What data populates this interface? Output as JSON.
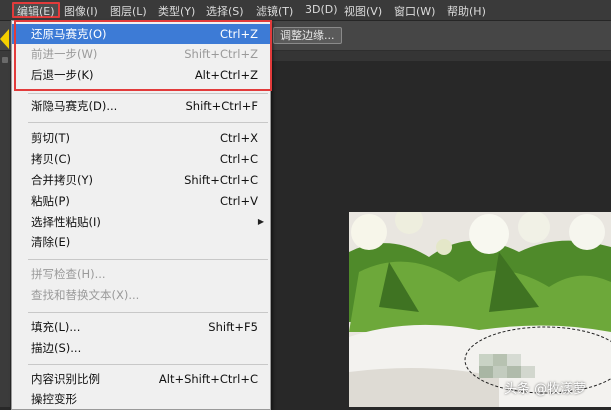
{
  "menubar": {
    "items": [
      "编辑(E)",
      "图像(I)",
      "图层(L)",
      "类型(Y)",
      "选择(S)",
      "滤镜(T)",
      "3D(D)",
      "视图(V)",
      "窗口(W)",
      "帮助(H)"
    ]
  },
  "optbar": {
    "refine_edge_label": "调整边缘..."
  },
  "dropdown": {
    "items": [
      {
        "label": "还原马赛克(O)",
        "shortcut": "Ctrl+Z"
      },
      {
        "label": "前进一步(W)",
        "shortcut": "Shift+Ctrl+Z"
      },
      {
        "label": "后退一步(K)",
        "shortcut": "Alt+Ctrl+Z"
      },
      {
        "label": "渐隐马赛克(D)...",
        "shortcut": "Shift+Ctrl+F"
      },
      {
        "label": "剪切(T)",
        "shortcut": "Ctrl+X"
      },
      {
        "label": "拷贝(C)",
        "shortcut": "Ctrl+C"
      },
      {
        "label": "合并拷贝(Y)",
        "shortcut": "Shift+Ctrl+C"
      },
      {
        "label": "粘贴(P)",
        "shortcut": "Ctrl+V"
      },
      {
        "label": "选择性粘贴(I)",
        "shortcut": ""
      },
      {
        "label": "清除(E)",
        "shortcut": ""
      },
      {
        "label": "拼写检查(H)...",
        "shortcut": ""
      },
      {
        "label": "查找和替换文本(X)...",
        "shortcut": ""
      },
      {
        "label": "填充(L)...",
        "shortcut": "Shift+F5"
      },
      {
        "label": "描边(S)...",
        "shortcut": ""
      },
      {
        "label": "内容识别比例",
        "shortcut": "Alt+Shift+Ctrl+C"
      },
      {
        "label": "操控变形",
        "shortcut": ""
      }
    ]
  },
  "watermark": "头条 @牧漾萝",
  "colors": {
    "highlight": "#3d7bd6",
    "annotation_red": "#e23b3b",
    "arrow_yellow": "#f5d000"
  }
}
